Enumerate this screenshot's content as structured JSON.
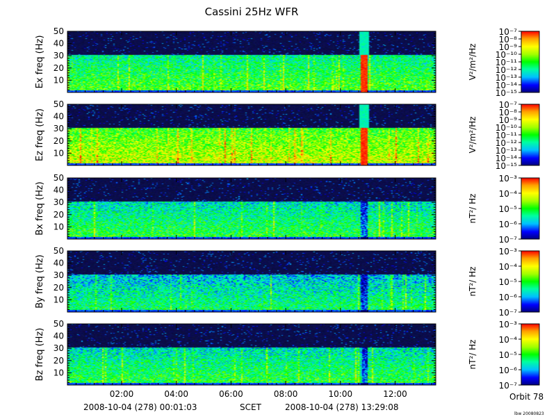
{
  "chart_data": {
    "type": "heatmap",
    "title": "Cassini 25Hz WFR",
    "x": {
      "tick_labels": [
        "02:00",
        "04:00",
        "06:00",
        "08:00",
        "10:00",
        "12:00"
      ],
      "tick_hours": [
        2,
        4,
        6,
        8,
        10,
        12
      ],
      "range_hours": [
        0.0175,
        13.4856
      ],
      "start_label": "2008-10-04 (278) 00:01:03",
      "axis_label": "SCET",
      "end_label": "2008-10-04 (278) 13:29:08"
    },
    "y_range": [
      0,
      50
    ],
    "y_tick_labels": [
      "50",
      "40",
      "30",
      "20",
      "10"
    ],
    "y_tick_values": [
      50,
      40,
      30,
      20,
      10
    ],
    "panels": [
      {
        "ylabel": "Ex freq (Hz)",
        "units": "V²/m²/Hz",
        "colorbar_labels": [
          "10⁻⁷",
          "10⁻⁸",
          "10⁻⁹",
          "10⁻¹⁰",
          "10⁻¹¹",
          "10⁻¹²",
          "10⁻¹³",
          "10⁻¹⁴",
          "10⁻¹⁵"
        ],
        "colorbar_exponents": [
          -7,
          -8,
          -9,
          -10,
          -11,
          -12,
          -13,
          -14,
          -15
        ],
        "intensity": 0.55
      },
      {
        "ylabel": "Ez freq (Hz)",
        "units": "V²/m²/Hz",
        "colorbar_labels": [
          "10⁻⁷",
          "10⁻⁸",
          "10⁻⁹",
          "10⁻¹⁰",
          "10⁻¹¹",
          "10⁻¹²",
          "10⁻¹³",
          "10⁻¹⁴",
          "10⁻¹⁵"
        ],
        "colorbar_exponents": [
          -7,
          -8,
          -9,
          -10,
          -11,
          -12,
          -13,
          -14,
          -15
        ],
        "intensity": 0.7
      },
      {
        "ylabel": "Bx freq (Hz)",
        "units": "nT²/ Hz",
        "colorbar_labels": [
          "10⁻³",
          "10⁻⁴",
          "10⁻⁵",
          "10⁻⁶",
          "10⁻⁷"
        ],
        "colorbar_exponents": [
          -3,
          -4,
          -5,
          -6,
          -7
        ],
        "intensity": 0.5
      },
      {
        "ylabel": "By freq (Hz)",
        "units": "nT²/ Hz",
        "colorbar_labels": [
          "10⁻³",
          "10⁻⁴",
          "10⁻⁵",
          "10⁻⁶",
          "10⁻⁷"
        ],
        "colorbar_exponents": [
          -3,
          -4,
          -5,
          -6,
          -7
        ],
        "intensity": 0.45
      },
      {
        "ylabel": "Bz freq (Hz)",
        "units": "nT²/ Hz",
        "colorbar_labels": [
          "10⁻³",
          "10⁻⁴",
          "10⁻⁵",
          "10⁻⁶",
          "10⁻⁷"
        ],
        "colorbar_exponents": [
          -3,
          -4,
          -5,
          -6,
          -7
        ],
        "intensity": 0.5
      }
    ],
    "colormap": [
      "#000080",
      "#0000ff",
      "#00c0ff",
      "#00ffa0",
      "#00ff00",
      "#a0ff00",
      "#ffff00",
      "#ffa000",
      "#ff0000"
    ],
    "background_color": "#06083c",
    "orbit": "Orbit 78",
    "credit": "lbw 20080823"
  }
}
